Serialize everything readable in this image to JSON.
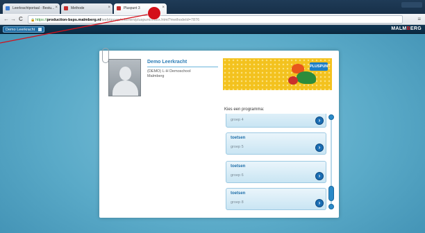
{
  "browser": {
    "tabs": [
      {
        "label": "Leerkrachtportaal - Bestu...",
        "fav_color": "#3a7bd5"
      },
      {
        "label": "Methode",
        "fav_color": "#c42b2b"
      },
      {
        "label": "Pluspunt 3",
        "fav_color": "#c42b2b"
      }
    ],
    "url": {
      "lock": "🔒",
      "scheme": "https://",
      "host": "production-bsps.malmberg.nl",
      "path": "/web/groep/rekenen/pluspunt/index.html?methodeId=7876"
    },
    "nav": {
      "back": "←",
      "forward": "→",
      "reload": "C",
      "menu": "≡"
    }
  },
  "appbar": {
    "user_label": "Demo Leerkracht",
    "brand_prefix": "MALM",
    "brand_accent": "B",
    "brand_suffix": "ERG"
  },
  "teacher": {
    "name": "Demo Leerkracht",
    "school_line1": "(DEMO) L-H Demoschool",
    "school_line2": "Malmberg"
  },
  "banner": {
    "logo_text": "PLUSPUNT"
  },
  "programs": {
    "heading": "Kies een programma:",
    "items": [
      {
        "title": "",
        "subtitle": "groep 4"
      },
      {
        "title": "toetsen",
        "subtitle": "groep 5"
      },
      {
        "title": "toetsen",
        "subtitle": "groep 6"
      },
      {
        "title": "toetsen",
        "subtitle": "groep 8"
      }
    ],
    "go_glyph": "›"
  },
  "colors": {
    "accent": "#2a7bb5",
    "annotation": "#d4101a",
    "banner": "#f3c21e"
  }
}
